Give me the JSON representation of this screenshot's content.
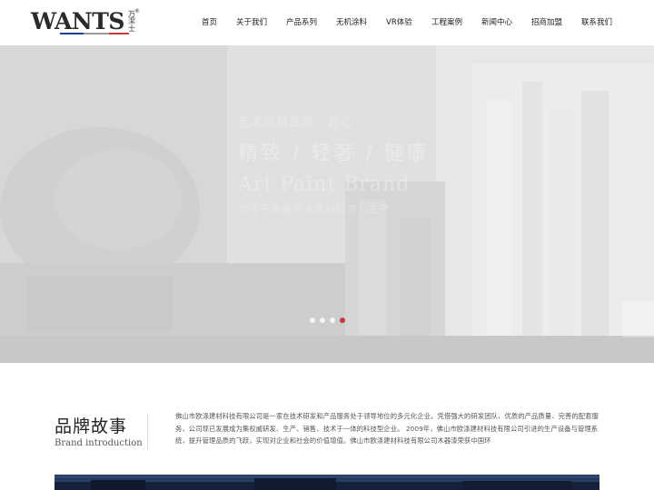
{
  "logo": {
    "word": "WANTS",
    "sub": "万潔士",
    "reg": "®"
  },
  "nav": [
    "首页",
    "关于我们",
    "产品系列",
    "无机涂料",
    "VR体验",
    "工程案例",
    "新闻中心",
    "招商加盟",
    "联系我们"
  ],
  "hero": {
    "line1": "艺术涂料品牌 · 匠心",
    "line2": "精致 / 轻奢 / 健康",
    "line3": "Art Paint Brand",
    "line4": "专注于高端艺术涂料研发与生产",
    "slides": 4,
    "active_slide": 4
  },
  "brand": {
    "title": "品牌故事",
    "subtitle": "Brand introduction",
    "paragraph": "佛山市欧涤建材科技有限公司是一家在技术研发和产品服务处于领导地位的多元化企业。凭借强大的研发团队、优质的产品质量、完善的配套服务，公司现已发展成为集权威研发、生产、销售、技术于一体的科技型企业。 2009年，佛山市欧涤建材科技有限公司引进的生产设备与管理系统，提升管理品质的飞跃，实现对企业和社会的价值增值。佛山市欧涤建材科技有限公司木器漆荣获中国环"
  },
  "colors": {
    "accent": "#c9383b",
    "logo_blue": "#1f3f8f",
    "logo_red": "#c9383b"
  }
}
